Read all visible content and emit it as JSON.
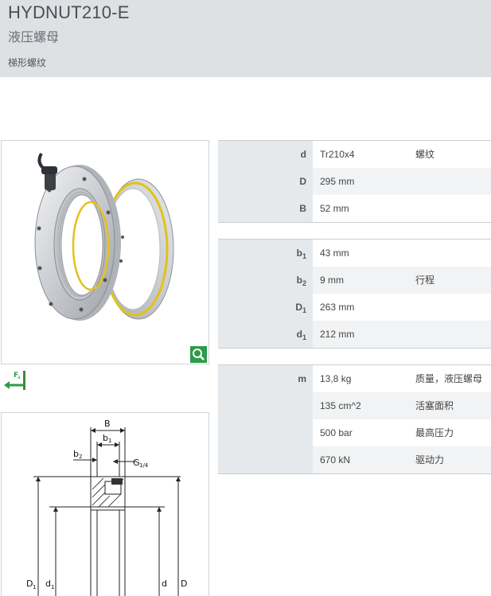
{
  "header": {
    "title": "HYDNUT210-E",
    "subtitle": "液压螺母",
    "description": "梯形螺纹"
  },
  "drawing_labels": {
    "B": "B",
    "b1": "b",
    "b1_sub": "1",
    "b2": "b",
    "b2_sub": "2",
    "G": "G",
    "G_sub": "1/4",
    "D1": "D",
    "D1_sub": "1",
    "d1": "d",
    "d1_sub": "1",
    "d": "d",
    "D": "D"
  },
  "icons": {
    "zoom": "magnifier-icon",
    "force": "axial-force-icon",
    "force_label": "F",
    "force_sub": "a"
  },
  "table1": [
    {
      "label": "d",
      "sub": "",
      "value": "Tr210x4",
      "note": "螺纹"
    },
    {
      "label": "D",
      "sub": "",
      "value": "295  mm",
      "note": ""
    },
    {
      "label": "B",
      "sub": "",
      "value": "52  mm",
      "note": ""
    }
  ],
  "table2": [
    {
      "label": "b",
      "sub": "1",
      "value": "43  mm",
      "note": ""
    },
    {
      "label": "b",
      "sub": "2",
      "value": "9  mm",
      "note": "行程"
    },
    {
      "label": "D",
      "sub": "1",
      "value": "263  mm",
      "note": ""
    },
    {
      "label": "d",
      "sub": "1",
      "value": "212  mm",
      "note": ""
    }
  ],
  "table3": [
    {
      "label": "m",
      "sub": "",
      "value": "13,8  kg",
      "note": "质量，液压螺母"
    },
    {
      "label": "",
      "sub": "",
      "value": "135  cm^2",
      "note": "活塞面积"
    },
    {
      "label": "",
      "sub": "",
      "value": "500  bar",
      "note": "最高压力"
    },
    {
      "label": "",
      "sub": "",
      "value": "670  kN",
      "note": "驱动力"
    }
  ]
}
